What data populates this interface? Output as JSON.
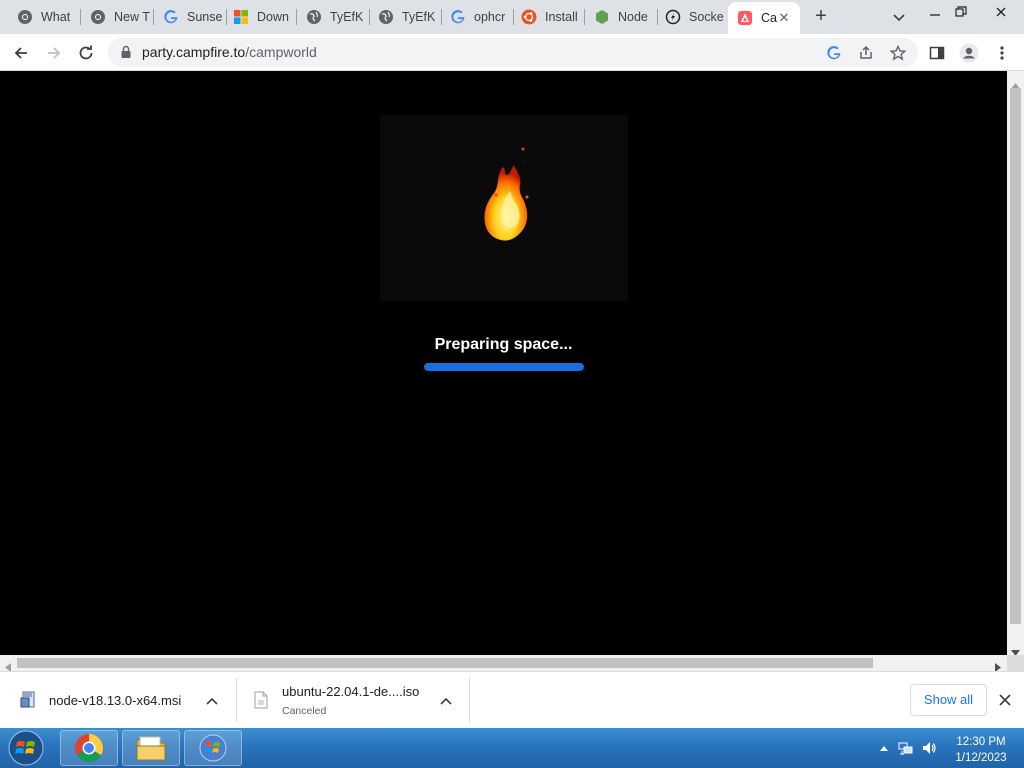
{
  "browser": {
    "tabs": [
      {
        "title": "What",
        "icon": "chrome-icon",
        "active": false
      },
      {
        "title": "New T",
        "icon": "chrome-icon",
        "active": false
      },
      {
        "title": "Sunse",
        "icon": "google-icon",
        "active": false
      },
      {
        "title": "Down",
        "icon": "microsoft-icon",
        "active": false
      },
      {
        "title": "TyEfK",
        "icon": "globe-icon",
        "active": false
      },
      {
        "title": "TyEfK",
        "icon": "globe-icon",
        "active": false
      },
      {
        "title": "ophcr",
        "icon": "google-icon",
        "active": false
      },
      {
        "title": "Install",
        "icon": "ubuntu-icon",
        "active": false
      },
      {
        "title": "Node",
        "icon": "nodejs-icon",
        "active": false
      },
      {
        "title": "Socke",
        "icon": "socketio-icon",
        "active": false
      },
      {
        "title": "Ca",
        "icon": "campfire-icon",
        "active": true
      }
    ],
    "new_tab_label": "+",
    "close_tab_label": "✕",
    "address": {
      "host": "party.campfire.to",
      "path": "/campworld"
    }
  },
  "page": {
    "loading_text": "Preparing space...",
    "progress_fraction": 1.0,
    "accent_color": "#1a6fe0"
  },
  "downloads": {
    "items": [
      {
        "name": "node-v18.13.0-x64.msi",
        "status": ""
      },
      {
        "name": "ubuntu-22.04.1-de....iso",
        "status": "Canceled"
      }
    ],
    "show_all_label": "Show all"
  },
  "taskbar": {
    "time": "12:30 PM",
    "date": "1/12/2023"
  }
}
